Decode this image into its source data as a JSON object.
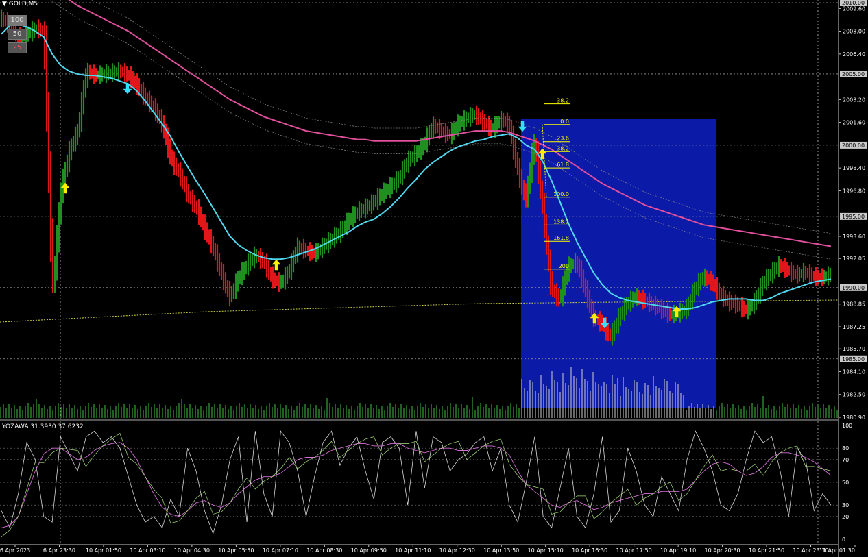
{
  "header": {
    "symbol": "GOLD,M5",
    "buttons": [
      "100",
      "50",
      "25"
    ]
  },
  "indicator": {
    "name": "YOZAWA",
    "value1": "31.3930",
    "value2": "37.6232",
    "levels": [
      "100",
      "80",
      "70",
      "50",
      "30",
      "20",
      "0"
    ]
  },
  "price_axis": {
    "ticks": [
      "2009.60",
      "2008.00",
      "2006.40",
      "2003.20",
      "2001.60",
      "1998.40",
      "1996.80",
      "1993.60",
      "1992.05",
      "1988.85",
      "1987.25",
      "1985.70",
      "1984.10",
      "1982.50",
      "1980.90"
    ],
    "highlighted": [
      "2010.00",
      "2005.00",
      "2000.00",
      "1995.00",
      "1990.00",
      "1985.00"
    ]
  },
  "time_axis": [
    "6 Apr 2023",
    "6 Apr 23:30",
    "10 Apr 01:50",
    "10 Apr 03:10",
    "10 Apr 04:30",
    "10 Apr 05:50",
    "10 Apr 07:10",
    "10 Apr 08:30",
    "10 Apr 09:50",
    "10 Apr 11:10",
    "10 Apr 12:30",
    "10 Apr 13:50",
    "10 Apr 15:10",
    "10 Apr 16:30",
    "10 Apr 17:50",
    "10 Apr 19:10",
    "10 Apr 20:30",
    "10 Apr 21:50",
    "10 Apr 23:10",
    "11 Apr 01:30"
  ],
  "fibonacci": {
    "levels": [
      {
        "label": "-38.2",
        "price": 2002.9
      },
      {
        "label": "0.0",
        "price": 2001.45
      },
      {
        "label": "23.6",
        "price": 2000.25
      },
      {
        "label": "38.2",
        "price": 1999.55
      },
      {
        "label": "61.8",
        "price": 1998.4
      },
      {
        "label": "100.0",
        "price": 1996.35
      },
      {
        "label": "138.2",
        "price": 1994.4
      },
      {
        "label": "161.8",
        "price": 1993.25
      },
      {
        "label": "200",
        "price": 1991.3
      }
    ]
  },
  "colors": {
    "up": "#1f8f1f",
    "down": "#e0161a",
    "ma_fast": "#4fd8ef",
    "ma_slow": "#e0509c",
    "box": "#0c1aa8",
    "fib": "#ffff00",
    "grid": "#9a9a9a"
  },
  "chart_data": {
    "type": "line",
    "title": "GOLD,M5",
    "ylim": [
      1980.9,
      2010.0
    ],
    "series": [
      {
        "name": "close",
        "values": [
          2008.9,
          2008.4,
          2007.5,
          2007.8,
          2008.2,
          2008.0,
          1989.5,
          1996.9,
          1999.6,
          2001.0,
          2005.2,
          2004.9,
          2005.0,
          2005.1,
          2005.2,
          2004.9,
          2004.2,
          2003.3,
          2002.6,
          2001.5,
          1999.0,
          1998.0,
          1996.5,
          1995.6,
          1994.1,
          1992.8,
          1990.9,
          1989.3,
          1990.7,
          1991.6,
          1992.3,
          1991.8,
          1990.6,
          1990.3,
          1991.2,
          1992.9,
          1992.6,
          1992.4,
          1992.9,
          1993.4,
          1993.9,
          1994.7,
          1995.3,
          1995.6,
          1996.0,
          1996.6,
          1997.1,
          1997.7,
          1998.9,
          1999.4,
          2000.1,
          2001.4,
          2001.0,
          2000.7,
          2001.5,
          2001.9,
          2002.2,
          2001.6,
          2001.1,
          2001.8,
          2001.5,
          1998.4,
          1996.0,
          2000.5,
          1995.5,
          1990.0,
          1989.1,
          1991.5,
          1991.8,
          1989.9,
          1987.9,
          1987.5,
          1986.5,
          1987.9,
          1988.9,
          1989.4,
          1989.1,
          1988.8,
          1988.5,
          1988.1,
          1988.2,
          1988.5,
          1989.9,
          1990.8,
          1990.4,
          1989.5,
          1989.0,
          1988.8,
          1988.4,
          1988.9,
          1990.3,
          1991.0,
          1991.6,
          1991.2,
          1990.9,
          1991.1,
          1990.8,
          1990.7,
          1990.9
        ]
      },
      {
        "name": "ma_fast",
        "values": [
          2007.8,
          2008.4,
          2008.5,
          2008.3,
          2008.0,
          2007.6,
          2006.4,
          2005.6,
          2005.2,
          2005.0,
          2004.9,
          2004.9,
          2004.8,
          2004.7,
          2004.5,
          2004.3,
          2003.8,
          2003.1,
          2002.3,
          2001.5,
          2000.6,
          1999.5,
          1998.5,
          1997.5,
          1996.6,
          1995.6,
          1994.6,
          1993.6,
          1993.0,
          1992.6,
          1992.3,
          1992.1,
          1992.0,
          1992.0,
          1992.1,
          1992.3,
          1992.5,
          1992.7,
          1993.0,
          1993.3,
          1993.6,
          1993.9,
          1994.3,
          1994.6,
          1994.8,
          1995.2,
          1995.7,
          1996.3,
          1997.0,
          1997.6,
          1998.3,
          1998.8,
          1999.2,
          1999.6,
          1999.9,
          2000.1,
          2000.3,
          2000.4,
          2000.6,
          2000.7,
          2000.8,
          2000.5,
          2000.0,
          1999.7,
          1998.8,
          1997.5,
          1996.0,
          1994.5,
          1993.2,
          1992.1,
          1991.0,
          1990.2,
          1989.6,
          1989.3,
          1989.1,
          1989.0,
          1988.9,
          1988.8,
          1988.7,
          1988.6,
          1988.5,
          1988.5,
          1988.6,
          1988.8,
          1989.0,
          1989.1,
          1989.2,
          1989.2,
          1989.2,
          1989.1,
          1989.1,
          1989.3,
          1989.6,
          1989.8,
          1990.0,
          1990.2,
          1990.4,
          1990.5,
          1990.6
        ]
      },
      {
        "name": "ma_slow",
        "values": [
          2014.0,
          2013.5,
          2013.0,
          2012.5,
          2012.0,
          2011.5,
          2011.0,
          2010.6,
          2010.2,
          2009.8,
          2009.5,
          2009.2,
          2008.9,
          2008.6,
          2008.3,
          2008.0,
          2007.6,
          2007.2,
          2006.8,
          2006.4,
          2006.0,
          2005.6,
          2005.2,
          2004.8,
          2004.4,
          2004.0,
          2003.6,
          2003.2,
          2002.9,
          2002.6,
          2002.3,
          2002.0,
          2001.8,
          2001.6,
          2001.4,
          2001.2,
          2001.0,
          2000.9,
          2000.8,
          2000.7,
          2000.6,
          2000.5,
          2000.4,
          2000.4,
          2000.3,
          2000.3,
          2000.3,
          2000.3,
          2000.3,
          2000.3,
          2000.4,
          2000.5,
          2000.6,
          2000.7,
          2000.8,
          2000.9,
          2001.0,
          2001.0,
          2001.0,
          2001.0,
          2000.9,
          2000.7,
          2000.5,
          2000.3,
          2000.0,
          1999.7,
          1999.3,
          1998.9,
          1998.5,
          1998.1,
          1997.7,
          1997.3,
          1997.0,
          1996.7,
          1996.4,
          1996.1,
          1995.8,
          1995.6,
          1995.4,
          1995.2,
          1995.0,
          1994.8,
          1994.6,
          1994.4,
          1994.3,
          1994.2,
          1994.1,
          1994.0,
          1993.9,
          1993.8,
          1993.7,
          1993.6,
          1993.5,
          1993.4,
          1993.3,
          1993.2,
          1993.1,
          1993.0,
          1992.9
        ]
      },
      {
        "name": "yozawa_fast",
        "values": [
          25,
          10,
          40,
          85,
          70,
          20,
          15,
          90,
          75,
          60,
          90,
          95,
          85,
          90,
          80,
          55,
          30,
          15,
          20,
          10,
          35,
          20,
          80,
          60,
          25,
          5,
          30,
          70,
          90,
          15,
          95,
          40,
          20,
          95,
          85,
          60,
          20,
          55,
          85,
          95,
          65,
          80,
          90,
          60,
          35,
          85,
          90,
          80,
          30,
          95,
          45,
          90,
          85,
          60,
          70,
          75,
          85,
          90,
          60,
          80,
          30,
          15,
          50,
          90,
          20,
          10,
          45,
          80,
          20,
          10,
          40,
          90,
          15,
          25,
          80,
          60,
          30,
          20,
          55,
          40,
          25,
          70,
          95,
          80,
          60,
          30,
          25,
          40,
          70,
          95,
          85,
          90,
          60,
          20,
          80,
          70,
          25,
          40,
          30
        ]
      },
      {
        "name": "yozawa_slow",
        "values": [
          10,
          12,
          20,
          40,
          60,
          75,
          80,
          80,
          75,
          70,
          72,
          78,
          82,
          84,
          85,
          80,
          70,
          55,
          40,
          28,
          22,
          20,
          25,
          32,
          34,
          30,
          28,
          32,
          40,
          46,
          52,
          55,
          55,
          58,
          64,
          70,
          72,
          72,
          74,
          78,
          80,
          82,
          84,
          84,
          82,
          82,
          84,
          84,
          80,
          78,
          76,
          78,
          80,
          80,
          78,
          78,
          80,
          82,
          82,
          80,
          74,
          60,
          48,
          42,
          36,
          30,
          28,
          32,
          34,
          30,
          26,
          28,
          32,
          34,
          36,
          38,
          40,
          40,
          42,
          42,
          42,
          44,
          52,
          60,
          66,
          68,
          66,
          60,
          56,
          58,
          64,
          72,
          76,
          76,
          74,
          72,
          68,
          62,
          56
        ]
      }
    ],
    "notes": "Approximate values read off the chart (one point per ~8 bars)."
  }
}
